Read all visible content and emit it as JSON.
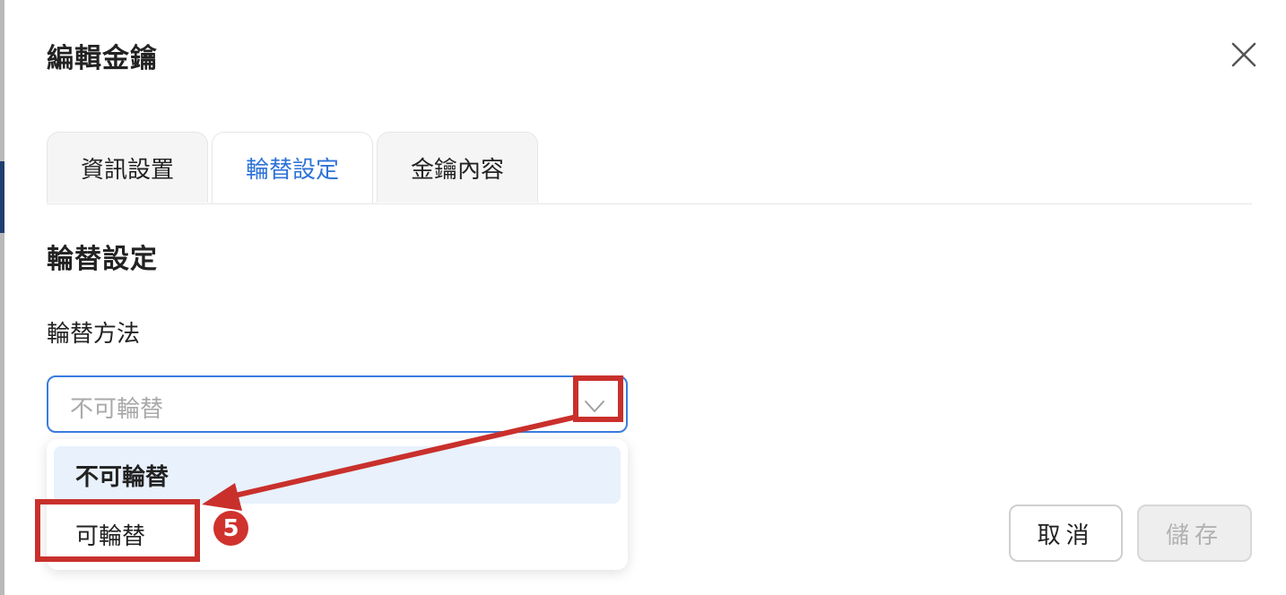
{
  "dialog": {
    "title": "編輯金鑰"
  },
  "tabs": [
    {
      "label": "資訊設置",
      "active": false
    },
    {
      "label": "輪替設定",
      "active": true
    },
    {
      "label": "金鑰內容",
      "active": false
    }
  ],
  "section": {
    "title": "輪替設定",
    "field_label": "輪替方法"
  },
  "select": {
    "placeholder": "不可輪替",
    "options": [
      {
        "label": "不可輪替",
        "highlighted": true
      },
      {
        "label": "可輪替",
        "highlighted": false
      }
    ]
  },
  "buttons": {
    "cancel": "取消",
    "save": "儲存"
  },
  "annotation": {
    "step": "5",
    "color": "#c9302c"
  },
  "colors": {
    "accent": "#2e73d9",
    "highlight_bg": "#e8f1fc"
  }
}
